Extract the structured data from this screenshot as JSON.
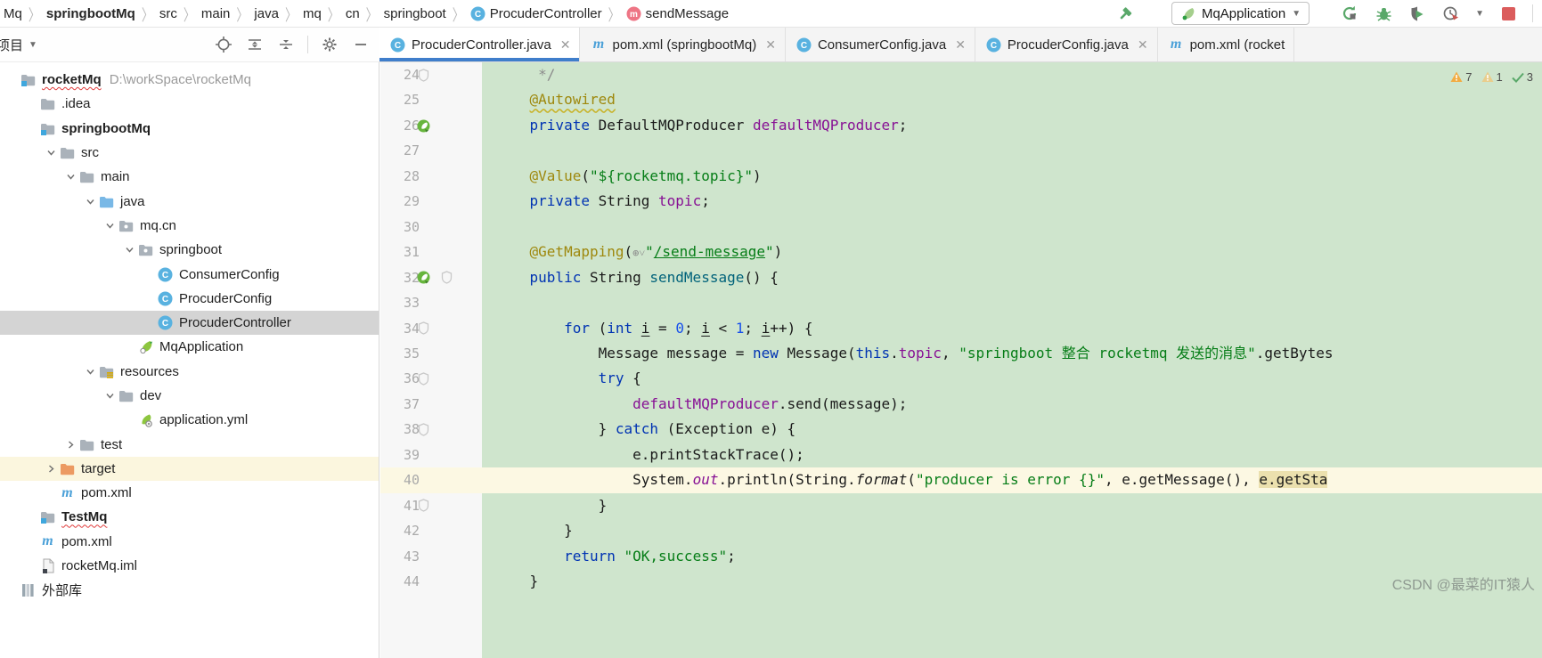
{
  "colors": {
    "accent_blue": "#3f7ecb",
    "editor_green": "#cfe5cd",
    "current_line": "#fcf8e3",
    "selection_tan": "#ebe0ae",
    "selected_row": "#d4d4d4",
    "target_row": "#fbf6de",
    "keyword": "#0033b3",
    "string": "#067d17",
    "number": "#1750eb",
    "field": "#871094",
    "annotation": "#9e880d",
    "stop_red": "#db5c5c",
    "run_green": "#59a869"
  },
  "breadcrumb": {
    "items": [
      {
        "label": "Mq"
      },
      {
        "label": "springbootMq",
        "bold": true
      },
      {
        "label": "src"
      },
      {
        "label": "main"
      },
      {
        "label": "java"
      },
      {
        "label": "mq"
      },
      {
        "label": "cn"
      },
      {
        "label": "springboot"
      },
      {
        "label": "ProcuderController",
        "icon": "class"
      },
      {
        "label": "sendMessage",
        "icon": "method"
      }
    ]
  },
  "run_widget": {
    "config_name": "MqApplication",
    "icons": [
      "hammer-icon",
      "spring-boot-run-icon",
      "rerun-icon",
      "debug-icon",
      "coverage-icon",
      "profiler-icon",
      "stop-icon"
    ]
  },
  "project_panel": {
    "title": "项目",
    "header_icons": [
      "locate-icon",
      "expand-all-icon",
      "collapse-all-icon",
      "settings-gear-icon",
      "hide-panel-icon"
    ],
    "tree": [
      {
        "depth": 0,
        "icon": "module",
        "label": "rocketMq",
        "bold": true,
        "wavy": true,
        "suffix": "D:\\workSpace\\rocketMq"
      },
      {
        "depth": 1,
        "icon": "folder",
        "label": ".idea"
      },
      {
        "depth": 1,
        "icon": "module",
        "label": "springbootMq",
        "bold": true
      },
      {
        "depth": 2,
        "icon": "folder",
        "label": "src",
        "expand": "open"
      },
      {
        "depth": 3,
        "icon": "folder",
        "label": "main",
        "expand": "open"
      },
      {
        "depth": 4,
        "icon": "folder-blue",
        "label": "java",
        "expand": "open"
      },
      {
        "depth": 5,
        "icon": "package",
        "label": "mq.cn",
        "expand": "open"
      },
      {
        "depth": 6,
        "icon": "package",
        "label": "springboot",
        "expand": "open"
      },
      {
        "depth": 7,
        "icon": "class",
        "label": "ConsumerConfig"
      },
      {
        "depth": 7,
        "icon": "class",
        "label": "ProcuderConfig"
      },
      {
        "depth": 7,
        "icon": "class",
        "label": "ProcuderController",
        "selected": true
      },
      {
        "depth": 6,
        "icon": "spring",
        "label": "MqApplication"
      },
      {
        "depth": 4,
        "icon": "resources",
        "label": "resources",
        "expand": "open"
      },
      {
        "depth": 5,
        "icon": "folder",
        "label": "dev",
        "expand": "open"
      },
      {
        "depth": 6,
        "icon": "yml",
        "label": "application.yml"
      },
      {
        "depth": 3,
        "icon": "folder",
        "label": "test",
        "expand": "closed"
      },
      {
        "depth": 2,
        "icon": "folder-orange",
        "label": "target",
        "expand": "closed",
        "rowHighlight": true
      },
      {
        "depth": 2,
        "icon": "maven",
        "label": "pom.xml"
      },
      {
        "depth": 1,
        "icon": "module",
        "label": "TestMq",
        "bold": true,
        "wavy": true
      },
      {
        "depth": 1,
        "icon": "maven",
        "label": "pom.xml"
      },
      {
        "depth": 1,
        "icon": "iml",
        "label": "rocketMq.iml"
      },
      {
        "depth": 0,
        "icon": "lib",
        "label": "外部库"
      }
    ]
  },
  "tabs": [
    {
      "icon": "class",
      "label": "ProcuderController.java",
      "selected": true,
      "close": true
    },
    {
      "icon": "maven",
      "label": "pom.xml (springbootMq)",
      "close": true
    },
    {
      "icon": "class",
      "label": "ConsumerConfig.java",
      "close": true
    },
    {
      "icon": "class",
      "label": "ProcuderConfig.java",
      "close": true
    },
    {
      "icon": "maven",
      "label": "pom.xml (rocket",
      "close": false
    }
  ],
  "editor": {
    "inspections": {
      "warnings": "7",
      "weak_warnings": "1",
      "passed": "3"
    },
    "lines": [
      {
        "n": 24,
        "gutter": [
          "lock"
        ],
        "segs": [
          [
            "cmt",
            "     */"
          ]
        ]
      },
      {
        "n": 25,
        "gutter": [],
        "segs": [
          [
            "plain",
            "    "
          ],
          [
            "annW",
            "@Autowired"
          ]
        ]
      },
      {
        "n": 26,
        "gutter": [
          "bean"
        ],
        "segs": [
          [
            "plain",
            "    "
          ],
          [
            "kw",
            "private"
          ],
          [
            "plain",
            " DefaultMQProducer "
          ],
          [
            "fld",
            "defaultMQProducer"
          ],
          [
            "plain",
            ";"
          ]
        ]
      },
      {
        "n": 27,
        "gutter": [],
        "segs": []
      },
      {
        "n": 28,
        "gutter": [],
        "segs": [
          [
            "plain",
            "    "
          ],
          [
            "ann",
            "@Value"
          ],
          [
            "plain",
            "("
          ],
          [
            "str",
            "\"${rocketmq.topic}\""
          ],
          [
            "plain",
            ")"
          ]
        ]
      },
      {
        "n": 29,
        "gutter": [],
        "segs": [
          [
            "plain",
            "    "
          ],
          [
            "kw",
            "private"
          ],
          [
            "plain",
            " String "
          ],
          [
            "fld",
            "topic"
          ],
          [
            "plain",
            ";"
          ]
        ]
      },
      {
        "n": 30,
        "gutter": [],
        "segs": []
      },
      {
        "n": 31,
        "gutter": [],
        "segs": [
          [
            "plain",
            "    "
          ],
          [
            "ann",
            "@GetMapping"
          ],
          [
            "plain",
            "("
          ],
          [
            "inlay",
            "⊕˅"
          ],
          [
            "str",
            "\""
          ],
          [
            "strU",
            "/send-message"
          ],
          [
            "str",
            "\""
          ],
          [
            "plain",
            ")"
          ]
        ]
      },
      {
        "n": 32,
        "gutter": [
          "bean",
          "lock"
        ],
        "segs": [
          [
            "plain",
            "    "
          ],
          [
            "kw",
            "public"
          ],
          [
            "plain",
            " String "
          ],
          [
            "mth",
            "sendMessage"
          ],
          [
            "plain",
            "() {"
          ]
        ]
      },
      {
        "n": 33,
        "gutter": [],
        "segs": []
      },
      {
        "n": 34,
        "gutter": [
          "lock"
        ],
        "segs": [
          [
            "plain",
            "        "
          ],
          [
            "kw",
            "for"
          ],
          [
            "plain",
            " ("
          ],
          [
            "kw",
            "int"
          ],
          [
            "plain",
            " "
          ],
          [
            "varU",
            "i"
          ],
          [
            "plain",
            " = "
          ],
          [
            "num",
            "0"
          ],
          [
            "plain",
            "; "
          ],
          [
            "varU",
            "i"
          ],
          [
            "plain",
            " < "
          ],
          [
            "num",
            "1"
          ],
          [
            "plain",
            "; "
          ],
          [
            "varU",
            "i"
          ],
          [
            "plain",
            "++) {"
          ]
        ]
      },
      {
        "n": 35,
        "gutter": [],
        "segs": [
          [
            "plain",
            "            Message message = "
          ],
          [
            "kw",
            "new"
          ],
          [
            "plain",
            " Message("
          ],
          [
            "kw",
            "this"
          ],
          [
            "plain",
            "."
          ],
          [
            "fld",
            "topic"
          ],
          [
            "plain",
            ", "
          ],
          [
            "str",
            "\"springboot 整合 rocketmq 发送的消息\""
          ],
          [
            "plain",
            ".getBytes"
          ]
        ]
      },
      {
        "n": 36,
        "gutter": [
          "lock"
        ],
        "segs": [
          [
            "plain",
            "            "
          ],
          [
            "kw",
            "try"
          ],
          [
            "plain",
            " {"
          ]
        ]
      },
      {
        "n": 37,
        "gutter": [],
        "segs": [
          [
            "plain",
            "                "
          ],
          [
            "fld",
            "defaultMQProducer"
          ],
          [
            "plain",
            ".send(message);"
          ]
        ]
      },
      {
        "n": 38,
        "gutter": [
          "lock"
        ],
        "segs": [
          [
            "plain",
            "            } "
          ],
          [
            "kw",
            "catch"
          ],
          [
            "plain",
            " (Exception e) {"
          ]
        ]
      },
      {
        "n": 39,
        "gutter": [],
        "segs": [
          [
            "plain",
            "                e.printStackTrace();"
          ]
        ]
      },
      {
        "n": 40,
        "gutter": [],
        "current": true,
        "segs": [
          [
            "plain",
            "                System."
          ],
          [
            "sfld",
            "out"
          ],
          [
            "plain",
            ".println(String."
          ],
          [
            "smth",
            "format"
          ],
          [
            "plain",
            "("
          ],
          [
            "str",
            "\"producer is error {}\""
          ],
          [
            "plain",
            ", e.getMessage(), "
          ],
          [
            "sel",
            "e.getSta"
          ]
        ]
      },
      {
        "n": 41,
        "gutter": [
          "lock"
        ],
        "segs": [
          [
            "plain",
            "            }"
          ]
        ]
      },
      {
        "n": 42,
        "gutter": [],
        "segs": [
          [
            "plain",
            "        }"
          ]
        ]
      },
      {
        "n": 43,
        "gutter": [],
        "segs": [
          [
            "plain",
            "        "
          ],
          [
            "kw",
            "return"
          ],
          [
            "plain",
            " "
          ],
          [
            "str",
            "\"OK,success\""
          ],
          [
            "plain",
            ";"
          ]
        ]
      },
      {
        "n": 44,
        "gutter": [],
        "segs": [
          [
            "plain",
            "    }"
          ]
        ]
      }
    ]
  },
  "watermark": "CSDN @最菜的IT猿人"
}
